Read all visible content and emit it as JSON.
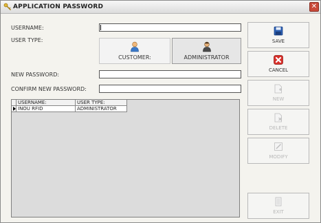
{
  "window": {
    "title": "APPLICATION PASSWORD",
    "close_glyph": "✕"
  },
  "form": {
    "username_label": "USERNAME:",
    "username_value": "",
    "user_type_label": "USER TYPE:",
    "new_password_label": "NEW PASSWORD:",
    "new_password_value": "",
    "confirm_password_label": "CONFIRM NEW PASSWORD:",
    "confirm_password_value": ""
  },
  "user_types": [
    {
      "label": "CUSTOMER:",
      "icon": "customer-user-icon",
      "selected": false
    },
    {
      "label": "ADMINISTRATOR",
      "icon": "administrator-user-icon",
      "selected": true
    }
  ],
  "grid": {
    "columns": [
      "USERNAME:",
      "USER TYPE:"
    ],
    "rows": [
      {
        "username": "INOU RFID",
        "user_type": "ADMINISTRATOR",
        "current": true
      }
    ]
  },
  "actions": [
    {
      "label": "SAVE",
      "icon": "floppy-disk-icon",
      "enabled": true
    },
    {
      "label": "CANCEL",
      "icon": "red-x-icon",
      "enabled": true
    },
    {
      "label": "NEW",
      "icon": "new-document-icon",
      "enabled": false
    },
    {
      "label": "DELETE",
      "icon": "delete-document-icon",
      "enabled": false
    },
    {
      "label": "MODIFY",
      "icon": "edit-pencil-icon",
      "enabled": false
    },
    {
      "label": "EXIT",
      "icon": "exit-door-icon",
      "enabled": false
    }
  ],
  "colors": {
    "cancel_red": "#d8302a",
    "save_blue": "#2b5fb3",
    "title_bar": "#e6e6e6",
    "disabled_text": "#b8b8b8"
  }
}
